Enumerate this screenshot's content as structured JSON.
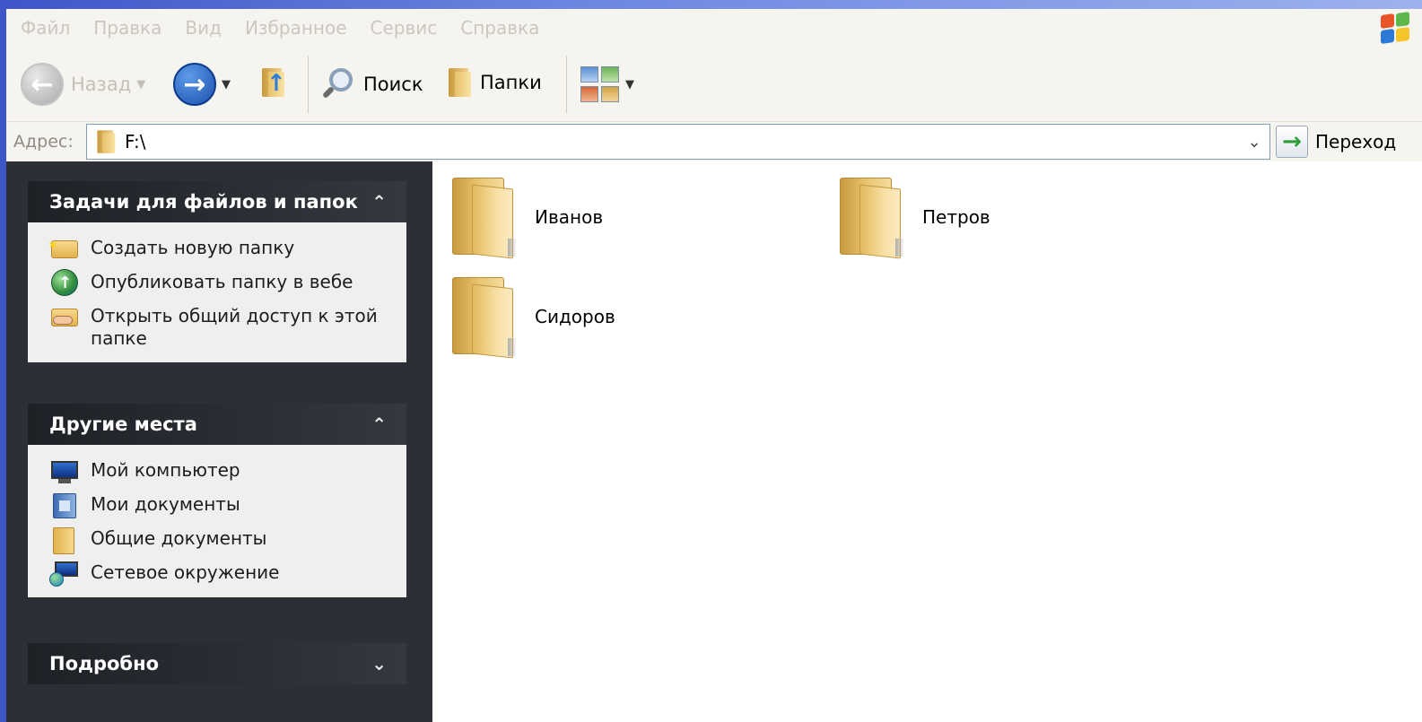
{
  "menu": [
    "Файл",
    "Правка",
    "Вид",
    "Избранное",
    "Сервис",
    "Справка"
  ],
  "toolbar": {
    "back_label": "Назад",
    "search_label": "Поиск",
    "folders_label": "Папки"
  },
  "address": {
    "label": "Адрес:",
    "value": "F:\\",
    "go_label": "Переход"
  },
  "tasks_panel": {
    "title": "Задачи для файлов и папок",
    "items": [
      {
        "label": "Создать новую папку",
        "icon": "new-folder-icon"
      },
      {
        "label": "Опубликовать папку в вебе",
        "icon": "publish-web-icon"
      },
      {
        "label": "Открыть общий доступ к этой папке",
        "icon": "share-folder-icon"
      }
    ]
  },
  "places_panel": {
    "title": "Другие места",
    "items": [
      {
        "label": "Мой компьютер",
        "icon": "computer-icon"
      },
      {
        "label": "Мои документы",
        "icon": "my-documents-icon"
      },
      {
        "label": "Общие документы",
        "icon": "shared-documents-icon"
      },
      {
        "label": "Сетевое окружение",
        "icon": "network-icon"
      }
    ]
  },
  "details_panel": {
    "title": "Подробно"
  },
  "folders": [
    {
      "name": "Иванов"
    },
    {
      "name": "Петров"
    },
    {
      "name": "Сидоров"
    }
  ]
}
